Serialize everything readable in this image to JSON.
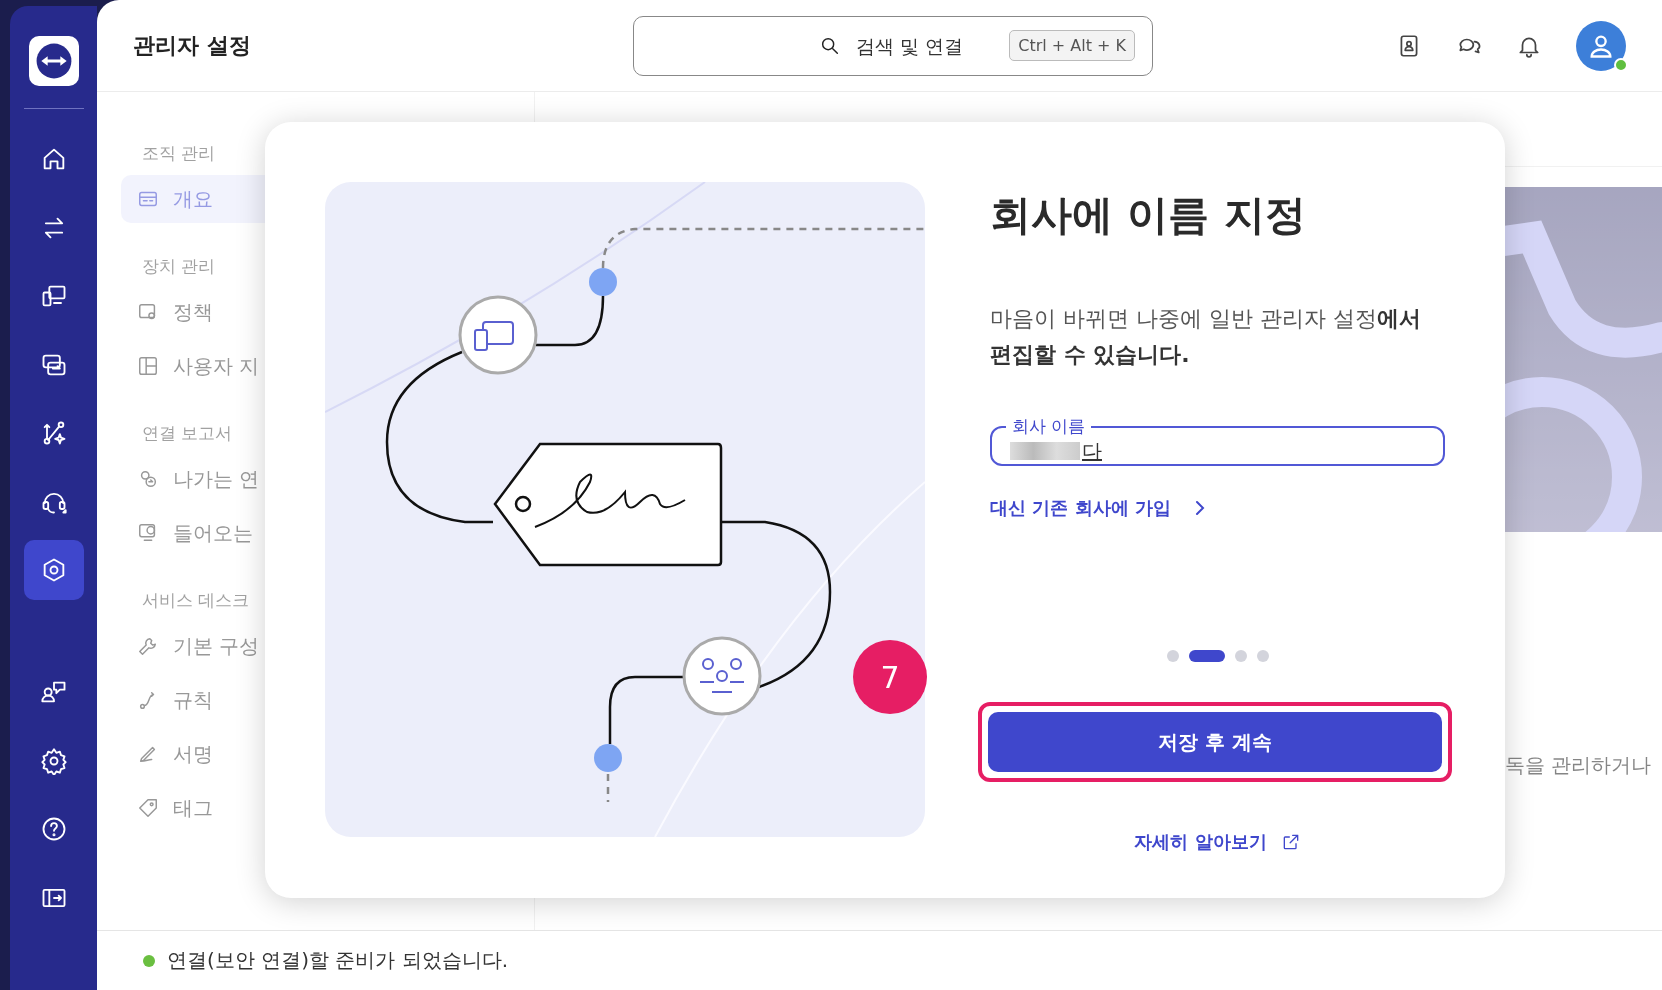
{
  "topbar": {
    "title": "관리자 설정",
    "search": {
      "placeholder": "검색 및 연결",
      "shortcut": "Ctrl + Alt + K"
    },
    "avatar": {
      "online": true
    }
  },
  "rail_items": [
    {
      "selected": false
    },
    {
      "selected": false
    },
    {
      "selected": false
    },
    {
      "selected": false
    },
    {
      "selected": false
    },
    {
      "selected": false
    },
    {
      "selected": true
    }
  ],
  "rail_bottom_items": [
    {
      "selected": false
    },
    {
      "selected": false
    },
    {
      "selected": false
    },
    {
      "selected": false
    }
  ],
  "sidebar": {
    "sections": [
      {
        "heading": "조직 관리",
        "items": [
          {
            "label": "개요",
            "selected": true
          }
        ]
      },
      {
        "heading": "장치 관리",
        "items": [
          {
            "label": "정책",
            "selected": false
          },
          {
            "label": "사용자 지",
            "selected": false
          }
        ]
      },
      {
        "heading": "연결 보고서",
        "items": [
          {
            "label": "나가는 연",
            "selected": false
          },
          {
            "label": "들어오는",
            "selected": false
          }
        ]
      },
      {
        "heading": "서비스 데스크",
        "items": [
          {
            "label": "기본 구성",
            "selected": false
          },
          {
            "label": "규칙",
            "selected": false
          },
          {
            "label": "서명",
            "selected": false
          },
          {
            "label": "태그",
            "selected": false
          }
        ]
      }
    ]
  },
  "background_text": "독을 관리하거나",
  "dialog": {
    "title": "회사에 이름 지정",
    "description": "마음이 바뀌면 나중에 일반 관리자 설정**에서 편집할 수 있습니다.**",
    "field": {
      "label": "회사 이름",
      "value": "다"
    },
    "join_link": "대신 기존 회사에 가입",
    "steps": [
      {
        "selected": false
      },
      {
        "selected": true
      },
      {
        "selected": false
      },
      {
        "selected": false
      }
    ],
    "primary_button": "저장 후 계속",
    "step_badge": "7",
    "learn_more": "자세히 알아보기"
  },
  "status_bar": {
    "text": "연결(보안 연결)할 준비가 되었습니다.",
    "online": true
  }
}
